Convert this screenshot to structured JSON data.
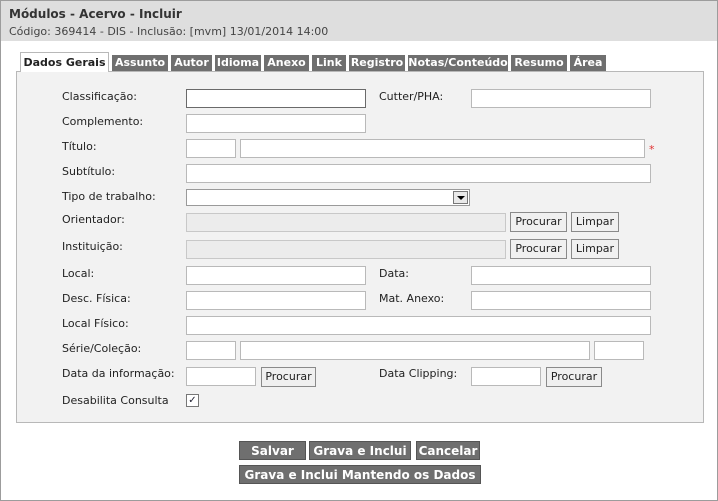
{
  "header": {
    "title": "Módulos - Acervo - Incluir",
    "subtitle": "Código: 369414 - DIS - Inclusão: [mvm] 13/01/2014 14:00"
  },
  "tabs": [
    {
      "label": "Dados Gerais",
      "active": true
    },
    {
      "label": "Assunto"
    },
    {
      "label": "Autor"
    },
    {
      "label": "Idioma"
    },
    {
      "label": "Anexo"
    },
    {
      "label": "Link"
    },
    {
      "label": "Registro"
    },
    {
      "label": "Notas/Conteúdo"
    },
    {
      "label": "Resumo"
    },
    {
      "label": "Área"
    }
  ],
  "form": {
    "classificacao": {
      "label": "Classificação:",
      "value": ""
    },
    "cutter": {
      "label": "Cutter/PHA:",
      "value": ""
    },
    "complemento": {
      "label": "Complemento:",
      "value": ""
    },
    "titulo": {
      "label": "Título:",
      "prefix_value": "",
      "value": "",
      "required_mark": "*"
    },
    "subtitulo": {
      "label": "Subtítulo:",
      "value": ""
    },
    "tipo_trabalho": {
      "label": "Tipo de trabalho:",
      "selected": ""
    },
    "orientador": {
      "label": "Orientador:",
      "value": ""
    },
    "instituicao": {
      "label": "Instituição:",
      "value": ""
    },
    "local": {
      "label": "Local:",
      "value": ""
    },
    "data": {
      "label": "Data:",
      "value": ""
    },
    "desc_fisica": {
      "label": "Desc. Física:",
      "value": ""
    },
    "mat_anexo": {
      "label": "Mat. Anexo:",
      "value": ""
    },
    "local_fisico": {
      "label": "Local Físico:",
      "value": ""
    },
    "serie_colecao": {
      "label": "Série/Coleção:",
      "value1": "",
      "value2": "",
      "value3": ""
    },
    "data_informacao": {
      "label": "Data da informação:",
      "value": ""
    },
    "data_clipping": {
      "label": "Data Clipping:",
      "value": ""
    },
    "desabilita_consulta": {
      "label": "Desabilita Consulta",
      "checked": true,
      "check_glyph": "✓"
    }
  },
  "buttons": {
    "procurar": "Procurar",
    "limpar": "Limpar"
  },
  "actions": {
    "salvar": "Salvar",
    "grava_inclui": "Grava e Inclui",
    "cancelar": "Cancelar",
    "grava_inclui_mantendo": "Grava e Inclui Mantendo os Dados"
  }
}
